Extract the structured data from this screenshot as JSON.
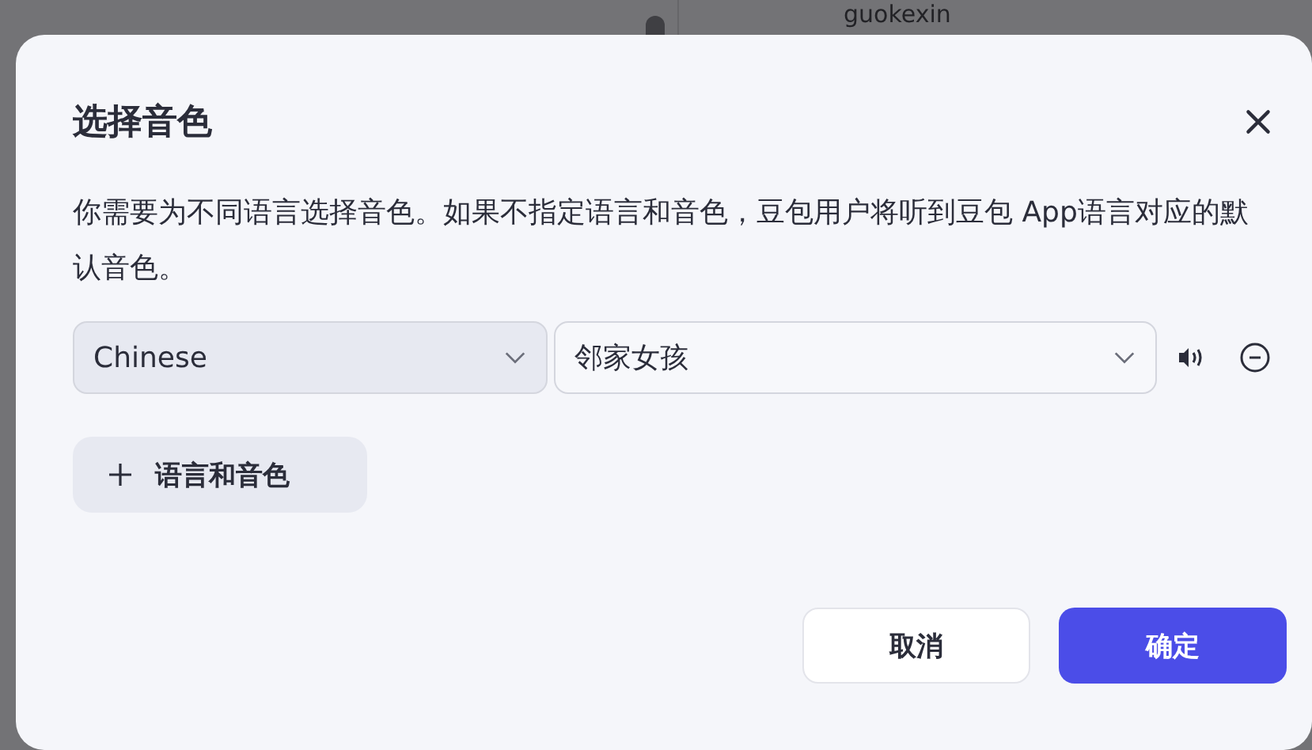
{
  "background": {
    "username": "guokexin"
  },
  "dialog": {
    "title": "选择音色",
    "description": "你需要为不同语言选择音色。如果不指定语言和音色，豆包用户将听到豆包 App语言对应的默认音色。",
    "rows": [
      {
        "language": {
          "value": "Chinese",
          "disabled": true
        },
        "voice": {
          "value": "邻家女孩",
          "disabled": false
        }
      }
    ],
    "add_button": "语言和音色",
    "buttons": [
      {
        "label": "取消",
        "kind": "secondary"
      },
      {
        "label": "确定",
        "kind": "primary"
      }
    ]
  }
}
